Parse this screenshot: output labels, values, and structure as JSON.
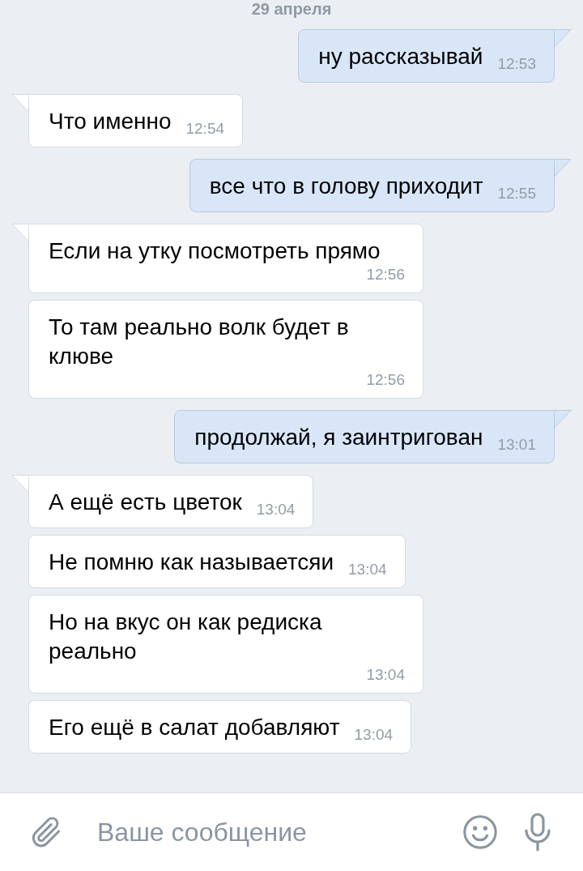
{
  "date_separator": "29 апреля",
  "messages": [
    {
      "text": "ну рассказывай",
      "time": "12:53",
      "outgoing": true,
      "tail": true
    },
    {
      "text": "Что именно",
      "time": "12:54",
      "outgoing": false,
      "tail": true
    },
    {
      "text": "все что в голову приходит",
      "time": "12:55",
      "outgoing": true,
      "tail": true
    },
    {
      "text": "Если на утку посмотреть прямо",
      "time": "12:56",
      "outgoing": false,
      "tail": true
    },
    {
      "text": "То там реально волк будет в клюве",
      "time": "12:56",
      "outgoing": false,
      "tail": false
    },
    {
      "text": "продолжай, я заинтригован",
      "time": "13:01",
      "outgoing": true,
      "tail": true
    },
    {
      "text": "А ещё есть цветок",
      "time": "13:04",
      "outgoing": false,
      "tail": true
    },
    {
      "text": "Не помню как называетсяи",
      "time": "13:04",
      "outgoing": false,
      "tail": false
    },
    {
      "text": "Но на вкус он как редиска реально",
      "time": "13:04",
      "outgoing": false,
      "tail": false
    },
    {
      "text": "Его ещё в салат добавляют",
      "time": "13:04",
      "outgoing": false,
      "tail": false
    }
  ],
  "composer": {
    "placeholder": "Ваше сообщение"
  }
}
